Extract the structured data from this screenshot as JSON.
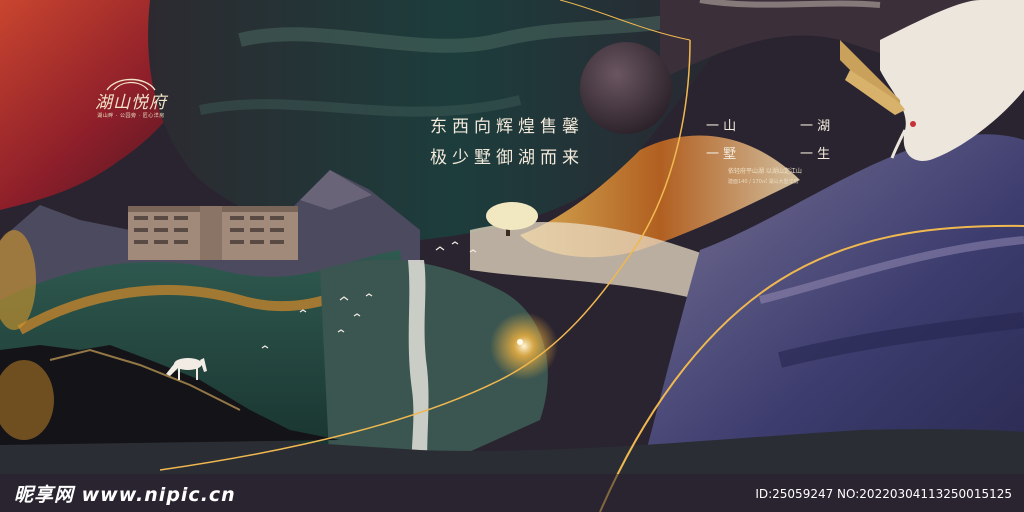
{
  "logo": {
    "name": "湖山悦府",
    "subtitle": "湖山畔 · 公园旁 · 匠心洋房"
  },
  "headline": {
    "line1": "东西向辉煌售馨",
    "line2": "极少墅御湖而来"
  },
  "slogan": {
    "left1": "一 山",
    "right1": "一 湖",
    "left2": "一 墅",
    "right2": "一 生"
  },
  "tagline": "依轻府平山湖  以湖山定江山",
  "spec": "建面140 / 170㎡ 湖山大墅洋房",
  "footer": {
    "watermark": "昵享网 www.nipic.cn",
    "id": "ID:25059247 NO:20220304113250015125"
  },
  "colors": {
    "red": "#b8322e",
    "dark_teal": "#1f3a3a",
    "gold": "#e0a040",
    "purple": "#4a4a7a",
    "moon": "#3a2e36"
  }
}
